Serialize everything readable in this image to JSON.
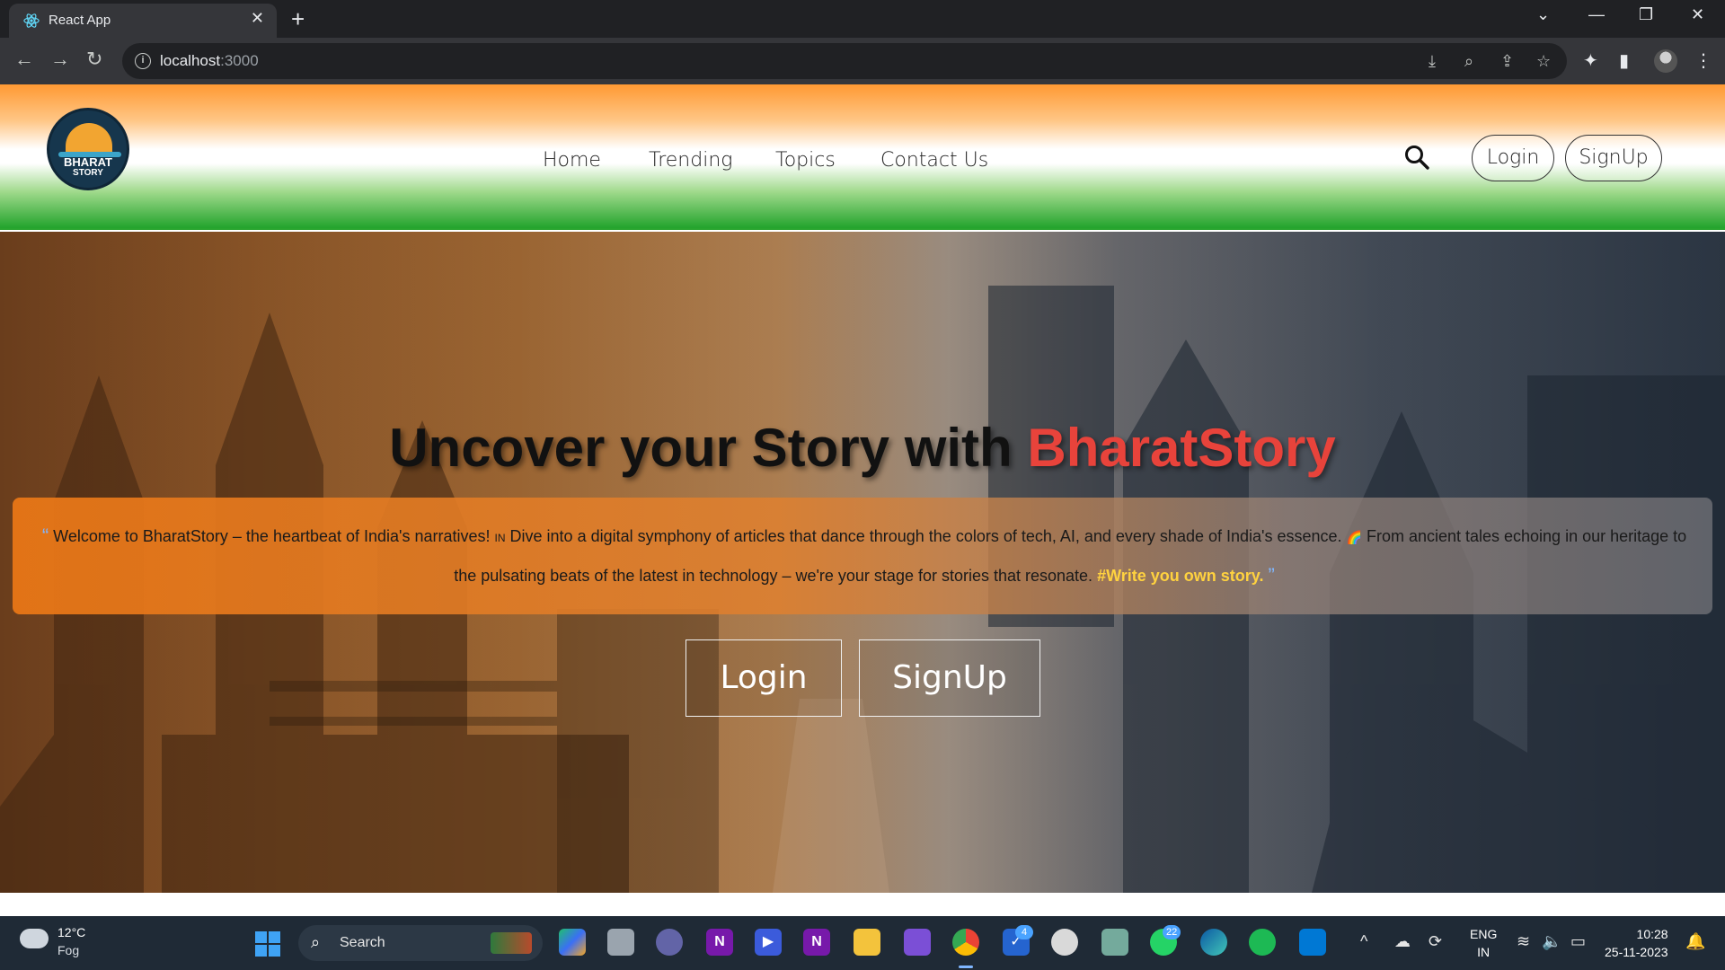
{
  "browser": {
    "tab_title": "React App",
    "url_host": "localhost",
    "url_port": ":3000"
  },
  "header": {
    "logo_text_line1": "BHARAT",
    "logo_text_line2": "STORY",
    "nav": [
      {
        "label": "Home"
      },
      {
        "label": "Trending"
      },
      {
        "label": "Topics"
      },
      {
        "label": "Contact Us"
      }
    ],
    "login_label": "Login",
    "signup_label": "SignUp"
  },
  "hero": {
    "title_prefix": "Uncover your Story with ",
    "title_brand": "BharatStory",
    "quote_part1": "Welcome to BharatStory – the heartbeat of India's narratives! ",
    "quote_flag": "IN",
    "quote_part2": " Dive into a digital symphony of articles that dance through the colors of tech, AI, and every shade of India's essence. ",
    "quote_emoji": "🌈",
    "quote_part3": " From ancient tales echoing in our heritage to the pulsating beats of the latest in technology – we're your stage for stories that resonate. ",
    "quote_hashtag": "#Write you own story.",
    "login_label": "Login",
    "signup_label": "SignUp"
  },
  "taskbar": {
    "weather_temp": "12°C",
    "weather_cond": "Fog",
    "search_label": "Search",
    "onenote_letter": "N",
    "todo_badge": "4",
    "whatsapp_badge": "22",
    "lang_line1": "ENG",
    "lang_line2": "IN",
    "time": "10:28",
    "date": "25-11-2023"
  },
  "colors": {
    "saffron": "#ff9933",
    "green": "#22a32c",
    "brand_red": "#e8433b",
    "hashtag_yellow": "#ffd23f"
  }
}
